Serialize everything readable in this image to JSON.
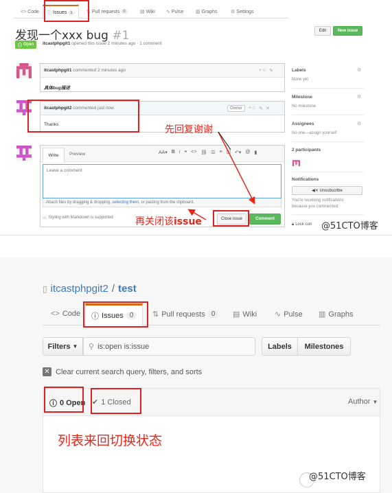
{
  "top": {
    "tabs": [
      {
        "label": "Code",
        "icon": "code-icon"
      },
      {
        "label": "Issues",
        "count": "1",
        "icon": "issue-opened-icon"
      },
      {
        "label": "Pull requests",
        "count": "0",
        "icon": "git-pull-request-icon"
      },
      {
        "label": "Wiki",
        "icon": "book-icon"
      },
      {
        "label": "Pulse",
        "icon": "pulse-icon"
      },
      {
        "label": "Graphs",
        "icon": "graph-icon"
      },
      {
        "label": "Settings",
        "icon": "gear-icon"
      }
    ],
    "issue_title": "发现一个xxx bug",
    "issue_number": "#1",
    "edit_label": "Edit",
    "new_issue_label": "New issue",
    "state_label": "Open",
    "meta_author": "itcastphpgit1",
    "meta_rest": " opened this issue 2 minutes ago · 1 comment",
    "comments": [
      {
        "author": "itcastphpgit1",
        "action": " commented 2 minutes ago",
        "body": "具体bug描述"
      },
      {
        "author": "itcastphpgit2",
        "action": " commented just now",
        "body": "Thanks",
        "badge": "Owner"
      }
    ],
    "editor": {
      "tab_write": "Write",
      "tab_preview": "Preview",
      "placeholder": "Leave a comment",
      "attach_text_1": "Attach files by dragging & dropping, ",
      "attach_link": "selecting them",
      "attach_text_2": ", or pasting from the clipboard.",
      "markdown_note": "Styling with Markdown is supported",
      "close_label": "Close issue",
      "comment_label": "Comment",
      "toolbar_aa": "AA▾",
      "toolbar_b": "B",
      "toolbar_i": "i"
    },
    "sidebar": {
      "labels_title": "Labels",
      "labels_value": "None yet",
      "milestone_title": "Milestone",
      "milestone_value": "No milestone",
      "assignees_title": "Assignees",
      "assignees_value": "No one—assign yourself",
      "participants_title": "2 participants",
      "notifications_title": "Notifications",
      "unsubscribe_label": "Unsubscribe",
      "notif_note_1": "You're receiving notifications",
      "notif_note_2": "because you commented.",
      "lock_label": "Lock con"
    },
    "annotations": {
      "reply_first": "先回复谢谢",
      "then_close_prefix": "再关闭该",
      "then_close_word": "issue"
    },
    "watermark": "@51CTO博客"
  },
  "bottom": {
    "owner": "itcastphpgit2",
    "separator": "/",
    "repo": "test",
    "tabs": [
      {
        "label": "Code",
        "icon": "code-icon"
      },
      {
        "label": "Issues",
        "count": "0",
        "icon": "issue-opened-icon"
      },
      {
        "label": "Pull requests",
        "count": "0",
        "icon": "git-pull-request-icon"
      },
      {
        "label": "Wiki",
        "icon": "book-icon"
      },
      {
        "label": "Pulse",
        "icon": "pulse-icon"
      },
      {
        "label": "Graphs",
        "icon": "graph-icon"
      }
    ],
    "filters_label": "Filters",
    "search_value": "is:open is:issue",
    "labels_btn": "Labels",
    "milestones_btn": "Milestones",
    "clear_label": "Clear current search query, filters, and sorts",
    "open_label": "0 Open",
    "closed_label": "1 Closed",
    "author_label": "Author",
    "annotation": "列表来回切换状态",
    "watermark": "@51CTO博客"
  },
  "colors": {
    "accent": "#d26911",
    "green": "#6cc644",
    "link": "#4078c0",
    "annotation_red": "#e8261a"
  }
}
